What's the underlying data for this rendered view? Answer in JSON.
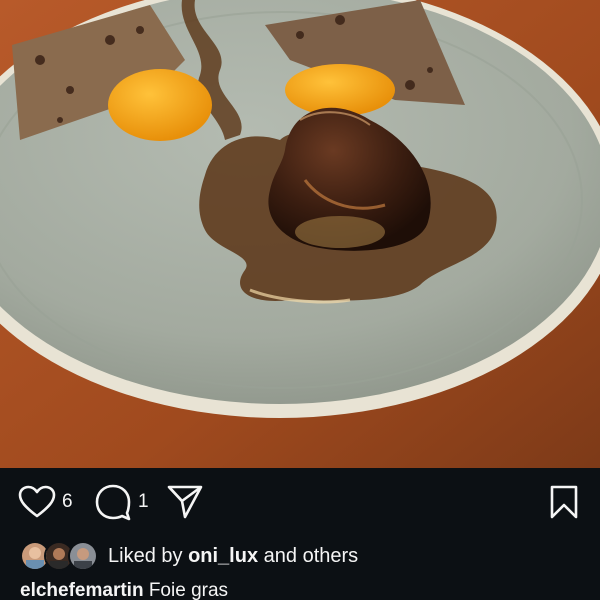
{
  "post": {
    "image_alt": "",
    "likes_count": "6",
    "comments_count": "1",
    "liked_by_prefix": "Liked by",
    "liked_by_user": "oni_lux",
    "liked_by_suffix": "and others",
    "caption_user": "elchefemartin",
    "caption_text": "Foie gras"
  },
  "icons": {
    "like": "heart-outline-icon",
    "comment": "comment-bubble-icon",
    "share": "paper-plane-icon",
    "save": "bookmark-outline-icon"
  },
  "colors": {
    "background": "#0c1014",
    "text": "#f5f5f5",
    "plate": "#a8b0a6",
    "table": "#a84f22"
  }
}
